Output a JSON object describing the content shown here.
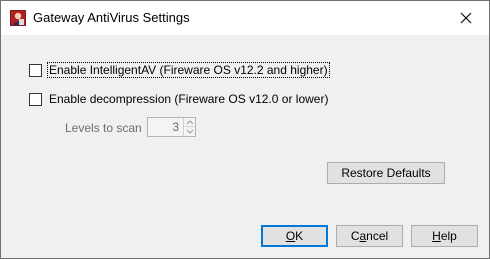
{
  "window": {
    "title": "Gateway AntiVirus Settings",
    "app_icon": "watchguard-app-icon",
    "close_icon": "close-icon"
  },
  "options": {
    "intelligent_av": {
      "label": "Enable IntelligentAV (Fireware OS v12.2 and higher)",
      "checked": false
    },
    "decompression": {
      "label": "Enable decompression (Fireware OS v12.0 or lower)",
      "checked": false
    }
  },
  "levels": {
    "label": "Levels to scan",
    "value": "3"
  },
  "buttons": {
    "restore_defaults": "Restore Defaults",
    "ok_mnemonic": "O",
    "ok_rest": "K",
    "cancel_pre": "C",
    "cancel_mnemonic": "a",
    "cancel_rest": "ncel",
    "help_mnemonic": "H",
    "help_rest": "elp"
  },
  "colors": {
    "dialog_bg": "#f0f0f0",
    "title_bg": "#ffffff",
    "default_button_border": "#0078d7",
    "disabled_text": "#6d6d6d"
  }
}
